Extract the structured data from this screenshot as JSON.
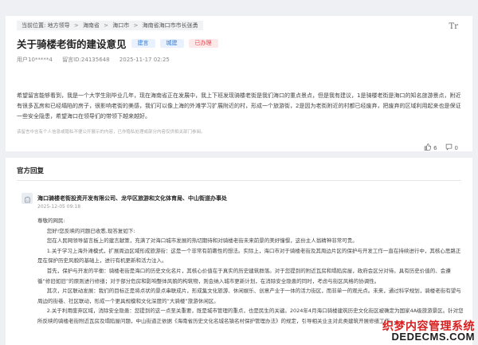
{
  "breadcrumb": {
    "label": "当前位置:",
    "items": [
      "地方领导",
      "海南省",
      "海口市",
      "海南省海口市市长张勇"
    ]
  },
  "font_toggle": "Tr",
  "message": {
    "title": "关于骑楼老街的建设意见",
    "tags": [
      "建言",
      "城建",
      "已办理"
    ],
    "user": "用户10*****4",
    "message_id": "留言ID:24135648",
    "datetime": "2025-11-17 02:25",
    "content": "希望留言能够看到，我是一个大学生刚毕业几年，现在海南省正在发展中，我上下班发现骑楼老街是我们海口的重点景点，但是我有建议，1是骑楼老街是海口的知名旅游景点，附近有很多瓦房和已经塌陷的房子，很影响老街的美感，我们可以像上海的外滩学习扩展附近的村，形成一个旅游街，2是因为老街附近的村都已经废弃，把废弃的区域利用起来也是保证一些安全隐患，希望海口在领导们的带领下越来越好。",
    "disclaimer": "该留言中含有个人信息或隐私不便公开展示的内容，已作隐私处理或部分内容仅供相关部门参阅。",
    "likes": "6",
    "comments": "0"
  },
  "reply": {
    "section_title": "官方回复",
    "org": "海口骑楼老街投资开发有限公司、龙华区旅游和文化体育局、中山街道办事处",
    "date": "2025-12-05 09:18",
    "paragraphs": [
      "尊敬的网民:",
      "您好!您反映的问题已收悉,现答复如下:",
      "您在人民网领导留言板上的建言献策，充满了对海口城市发展的热切期待和对骑楼老街未来前景的美好憧憬，这份主人翁精神非常可贵。",
      "1.关于学习上海外滩模式，扩展周边区域形成旅游街：这是一个非常有前瞻性的想法。实际上，海口市对于骑楼老街及其周边片区的保护与开发工作一直在持续进行中，其核心思路正是在保护历史风貌的基础上，进行有机更新和活力注入。",
      "首先，保护与开发的平衡：骑楼老街是海口的历史文化名片，其核心价值在于真实的历史建筑群落。对于您提到的附近瓦房和塌陷房屋，政府会区分对待。具有历史价值的、会遵循“修旧如旧”的原则进行修缮；对于部分危房和影响整体风貌的构筑物，则会纳入城市更新计划，在消除安全隐患的同时，考虑与街区风格的协调性。",
      "其次，片区联动发展：我们的目标正是将点状的景点串联成片，形成集文化旅游、休闲娱乐、创意产业于一体的活力街区，而非单一的观光点。未来，通过科学规划，骑楼老街有望与周边的街巷、社区联动，形成一个更具规模和文化深度的“大骑楼”旅游休闲区。",
      "2.关于利用废弃区域，消除安全隐患：您提到的这一点至关重要，既是城市管理的重点，也是民生的关键。2024年4月海口骑楼建筑历史文化街区被确定为国家4A级旅游景区。针对您所反映的骑楼老街附近瓦房及塌陷屋问题，中山街道正依据《海南省历史文化名城名镇名村保护管理办法》的规定，引导相关业主对此类建筑开展修缮工作。"
    ]
  },
  "watermark": {
    "line1": "织梦内容管理系统",
    "line2": "DEDECMS.COM"
  },
  "colors": {
    "accent_blue": "#2f7ad8",
    "status_red": "#e2434d",
    "background": "#eef0f3"
  }
}
